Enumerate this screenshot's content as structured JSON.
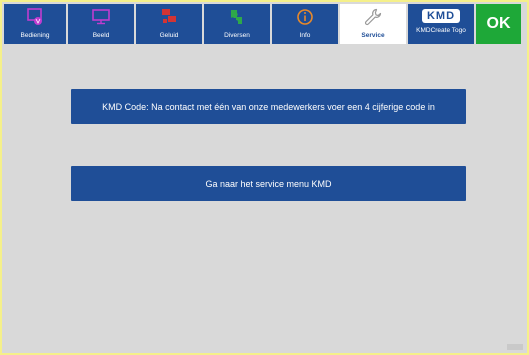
{
  "tabs": [
    {
      "label": "Bediening",
      "icon": "hand-touch-icon",
      "icon_color": "#c03cd0"
    },
    {
      "label": "Beeld",
      "icon": "monitor-icon",
      "icon_color": "#c03cd0"
    },
    {
      "label": "Geluid",
      "icon": "speaker-icon",
      "icon_color": "#d23434"
    },
    {
      "label": "Diversen",
      "icon": "puzzle-icon",
      "icon_color": "#2ea84a"
    },
    {
      "label": "Info",
      "icon": "info-icon",
      "icon_color": "#e8892a"
    },
    {
      "label": "Service",
      "icon": "wrench-icon",
      "icon_color": "#9a9a9a",
      "active": true
    },
    {
      "label": "KMDCreate Togo",
      "badge": "KMD"
    }
  ],
  "ok_button": {
    "label": "OK"
  },
  "kmd_code_text": "KMD Code:  Na contact met één van onze medewerkers voer een 4 cijferige code in",
  "service_menu_text": "Ga naar het service menu  KMD",
  "colors": {
    "tab_blue": "#1f4e97",
    "ok_green": "#1ea838",
    "background": "#d9d9d9",
    "frame_border": "#f5f08a"
  }
}
